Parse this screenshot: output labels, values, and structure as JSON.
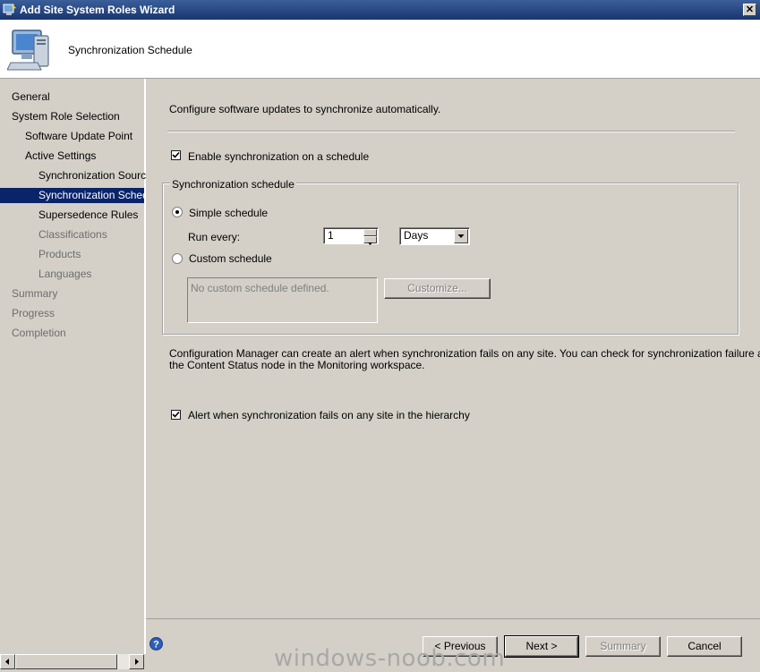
{
  "window": {
    "title": "Add Site System Roles Wizard",
    "close_glyph": "✕"
  },
  "header": {
    "title": "Synchronization Schedule"
  },
  "nav": {
    "items": [
      {
        "label": "General",
        "state": "normal"
      },
      {
        "label": "System Role Selection",
        "state": "normal"
      },
      {
        "label": "Software Update Point",
        "state": "normal"
      },
      {
        "label": "Active Settings",
        "state": "normal"
      },
      {
        "label": "Synchronization Source",
        "state": "normal"
      },
      {
        "label": "Synchronization Schedule",
        "state": "selected"
      },
      {
        "label": "Supersedence Rules",
        "state": "normal"
      },
      {
        "label": "Classifications",
        "state": "disabled"
      },
      {
        "label": "Products",
        "state": "disabled"
      },
      {
        "label": "Languages",
        "state": "disabled"
      },
      {
        "label": "Summary",
        "state": "disabled"
      },
      {
        "label": "Progress",
        "state": "disabled"
      },
      {
        "label": "Completion",
        "state": "disabled"
      }
    ]
  },
  "main": {
    "intro": "Configure software updates to synchronize automatically.",
    "enable_schedule_label": "Enable synchronization on a schedule",
    "enable_schedule_checked": true,
    "group_label": "Synchronization schedule",
    "simple_schedule_label": "Simple schedule",
    "simple_schedule_selected": true,
    "run_every_label": "Run every:",
    "run_every_value": "1",
    "run_every_unit": "Days",
    "custom_schedule_label": "Custom schedule",
    "custom_schedule_selected": false,
    "custom_schedule_placeholder": "No custom schedule defined.",
    "customize_button": "Customize...",
    "alert_info_line1": "Configuration Manager can create an alert when synchronization fails on any site. You can check for synchronization failure alerts in",
    "alert_info_line2": "the Content Status node in the Monitoring workspace.",
    "alert_checkbox_label": "Alert when synchronization fails on any site in the hierarchy",
    "alert_checked": true
  },
  "footer": {
    "previous_button": "< Previous",
    "next_button": "Next >",
    "summary_button": "Summary",
    "cancel_button": "Cancel"
  },
  "watermark": "windows-noob.com",
  "colors": {
    "selection": "#0a246a",
    "face": "#d4d0c8",
    "disabled_text": "#6d6d6d"
  }
}
